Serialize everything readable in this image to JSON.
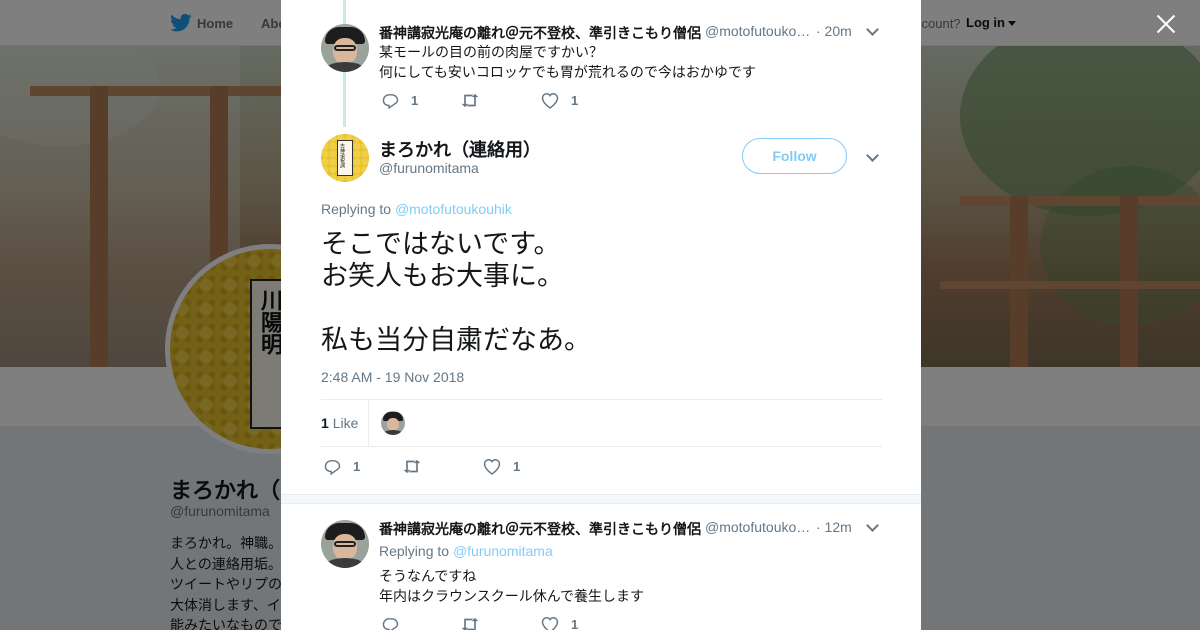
{
  "topnav": {
    "home_label": "Home",
    "about_label": "Abo",
    "account_text": "ccount?",
    "login_label": "Log in"
  },
  "profile": {
    "name": "まろかれ（連絡用）",
    "handle": "@furunomitama",
    "avatar_text": "古神道祝詞 CDブック 古川陽明",
    "bio_lines": [
      "まろかれ。神職。",
      "人との連絡用垢。",
      "ツイートやリプの",
      "大体消します、イ",
      "能みたいなもので"
    ]
  },
  "tweets": {
    "first": {
      "name": "番神講寂光庵の離れ＠元不登校、準引きこもり僧侶",
      "handle": "@motofutouko…",
      "time": "· 20m",
      "lines": [
        "某モールの目の前の肉屋ですかい？",
        "何にしても安いコロッケでも胃が荒れるので今はおかゆです"
      ],
      "reply_count": "1",
      "retweet_count": "",
      "like_count": "1"
    },
    "main": {
      "name": "まろかれ（連絡用）",
      "handle": "@furunomitama",
      "avatar_text": "古神道祝詞",
      "follow_label": "Follow",
      "replying_prefix": "Replying to ",
      "replying_handle": "@motofutoukouhik",
      "lines": [
        "そこではないです。",
        "お笑人もお大事に。",
        "",
        "私も当分自粛だなあ。"
      ],
      "timestamp": "2:48 AM - 19 Nov 2018",
      "likes_count": "1",
      "likes_label": "Like",
      "reply_count": "1",
      "retweet_count": "",
      "like_count": "1"
    },
    "reply": {
      "name": "番神講寂光庵の離れ＠元不登校、準引きこもり僧侶",
      "handle": "@motofutouko…",
      "time": "· 12m",
      "replying_prefix": "Replying to ",
      "replying_handle": "@furunomitama",
      "lines": [
        "そうなんですね",
        "年内はクラウンスクール休んで養生します"
      ],
      "reply_count": "",
      "retweet_count": "",
      "like_count": "1"
    }
  },
  "colors": {
    "accent": "#1da1f2",
    "text": "#14171a",
    "muted": "#657786",
    "thread": "#c4eedb",
    "overlay": "rgba(0,0,0,0.5)"
  },
  "icons": [
    "twitter-bird-icon",
    "close-icon",
    "reply-icon",
    "retweet-icon",
    "heart-icon",
    "chevron-down-icon"
  ]
}
